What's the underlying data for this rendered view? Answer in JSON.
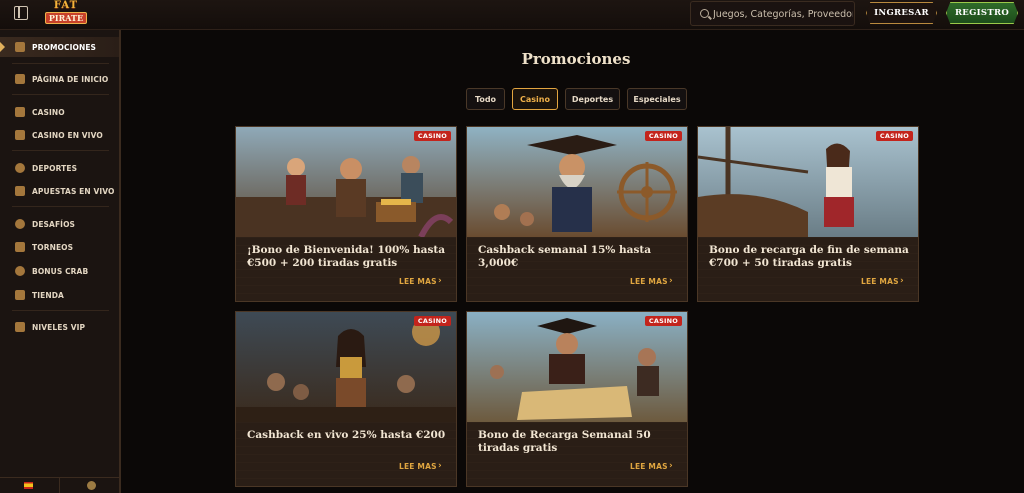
{
  "header": {
    "logo_line1": "FAT",
    "logo_line2": "PIRATE",
    "search_placeholder": "Juegos, Categorías, Proveedores",
    "login_label": "INGRESAR",
    "register_label": "REGISTRO"
  },
  "sidebar": {
    "items": [
      {
        "label": "PROMOCIONES",
        "icon": "gift-icon",
        "active": true
      },
      {
        "label": "PÁGINA DE INICIO",
        "icon": "home-icon"
      },
      {
        "label": "CASINO",
        "icon": "slot-machine-icon"
      },
      {
        "label": "CASINO EN VIVO",
        "icon": "live-casino-icon"
      },
      {
        "label": "DEPORTES",
        "icon": "soccer-ball-icon"
      },
      {
        "label": "APUESTAS EN VIVO",
        "icon": "live-bets-icon"
      },
      {
        "label": "DESAFÍOS",
        "icon": "medal-icon"
      },
      {
        "label": "TORNEOS",
        "icon": "trophy-icon"
      },
      {
        "label": "BONUS CRAB",
        "icon": "crab-icon"
      },
      {
        "label": "TIENDA",
        "icon": "shop-icon"
      },
      {
        "label": "NIVELES VIP",
        "icon": "diamond-icon"
      }
    ]
  },
  "main": {
    "title": "Promociones",
    "filters": [
      {
        "label": "Todo"
      },
      {
        "label": "Casino",
        "active": true
      },
      {
        "label": "Deportes"
      },
      {
        "label": "Especiales"
      }
    ],
    "cards": [
      {
        "badge": "CASINO",
        "title": "¡Bono de Bienvenida! 100% hasta €500 + 200 tiradas gratis",
        "more": "LEE MAS"
      },
      {
        "badge": "CASINO",
        "title": "Cashback semanal 15% hasta 3,000€",
        "more": "LEE MAS"
      },
      {
        "badge": "CASINO",
        "title": "Bono de recarga de fin de semana €700 + 50 tiradas gratis",
        "more": "LEE MAS"
      },
      {
        "badge": "CASINO",
        "title": "Cashback en vivo 25% hasta €200",
        "more": "LEE MAS"
      },
      {
        "badge": "CASINO",
        "title": "Bono de Recarga Semanal 50 tiradas gratis",
        "more": "LEE MAS"
      }
    ]
  },
  "colors": {
    "background": "#0b0807",
    "sidebar": "#1b1411",
    "accent_gold": "#e0a640",
    "badge_red": "#c3241c",
    "register_green": "#2f6b2a"
  }
}
